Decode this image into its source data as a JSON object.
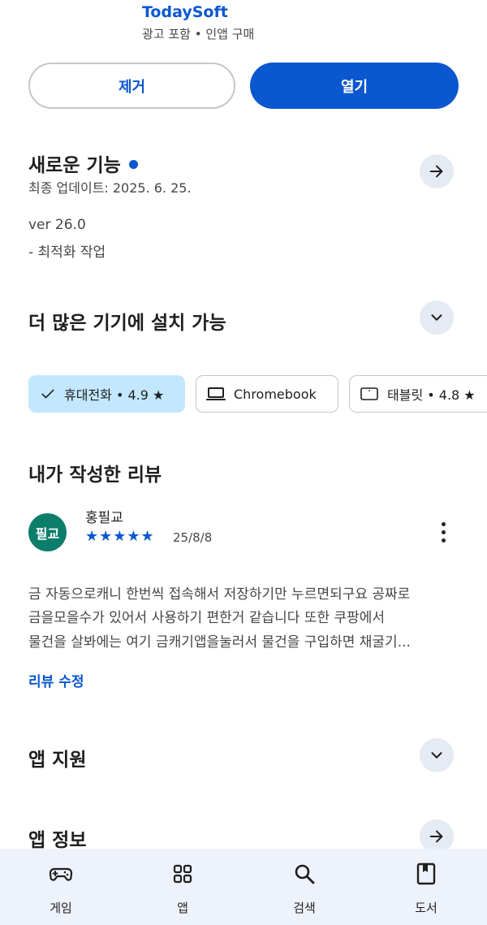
{
  "app": {
    "developer": "TodaySoft",
    "sub_info": "광고 포함 • 인앱 구매"
  },
  "actions": {
    "remove_label": "제거",
    "open_label": "열기"
  },
  "whats_new": {
    "title": "새로운 기능",
    "updated": "최종 업데이트: 2025. 6. 25.",
    "version": "ver 26.0",
    "note": "- 최적화 작업",
    "icon": "arrow-right-icon"
  },
  "devices": {
    "title": "더 많은 기기에 설치 가능",
    "icon": "chevron-down-icon",
    "chips": [
      {
        "label": "휴대전화 • 4.9 ★",
        "icon": "check-icon",
        "selected": true
      },
      {
        "label": "Chromebook",
        "icon": "laptop-icon",
        "selected": false
      },
      {
        "label": "태블릿 • 4.8 ★",
        "icon": "tablet-icon",
        "selected": false
      }
    ]
  },
  "my_review": {
    "title": "내가 작성한 리뷰",
    "avatar_text": "필교",
    "reviewer": "홍필교",
    "stars": "★★★★★",
    "rating": 5,
    "date": "25/8/8",
    "lines": [
      "금 자동으로캐니 한번씩 접속해서 저장하기만 누르면되구요 공짜로",
      "금을모을수가 있어서 사용하기 편한거 같습니다 또한 쿠팡에서",
      "물건을 살봐에는 여기 금캐기앱을눌러서 물건을 구입하면 채굴기..."
    ],
    "edit_label": "리뷰 수정"
  },
  "app_support": {
    "title": "앱 지원",
    "icon": "chevron-down-icon"
  },
  "app_info": {
    "title": "앱 정보",
    "icon": "arrow-right-icon"
  },
  "bottom_nav": [
    {
      "label": "게임",
      "icon": "gamepad-icon"
    },
    {
      "label": "앱",
      "icon": "apps-grid-icon"
    },
    {
      "label": "검색",
      "icon": "search-icon"
    },
    {
      "label": "도서",
      "icon": "book-icon"
    }
  ],
  "colors": {
    "accent": "#0b57d0",
    "chip_selected": "#c2e7ff",
    "avatar": "#0c7d6b",
    "nav_bg": "#eef2fa"
  }
}
